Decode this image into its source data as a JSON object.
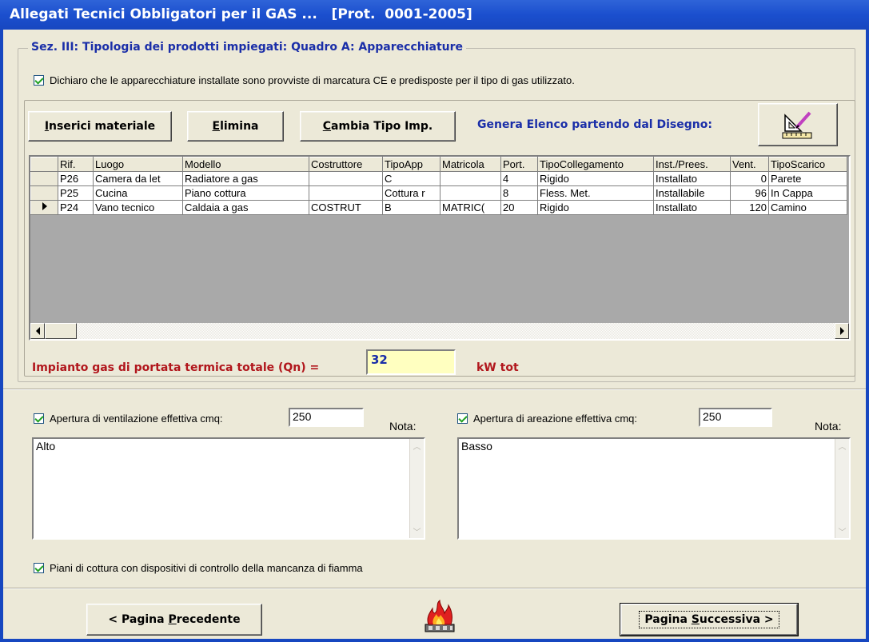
{
  "window": {
    "title": "Allegati Tecnici Obbligatori per il GAS ...   [Prot.  0001-2005]"
  },
  "section": {
    "title": "Sez. III: Tipologia dei prodotti impiegati:  Quadro A:  Apparecchiature",
    "ce_declaration": {
      "checked": true,
      "label": "Dichiaro che le apparecchiature installate sono provviste di marcatura CE e predisposte per il tipo di gas utilizzato."
    }
  },
  "toolbar": {
    "insert_label": "Inserici materiale",
    "delete_label": "Elimina",
    "change_type_label": "Cambia Tipo Imp.",
    "generate_label": "Genera Elenco partendo dal Disegno:",
    "drawing_icon": "drawing-tool-icon"
  },
  "grid": {
    "columns": [
      "Rif.",
      "Luogo",
      "Modello",
      "Costruttore",
      "TipoApp",
      "Matricola",
      "Port.",
      "TipoCollegamento",
      "Inst./Prees.",
      "Vent.",
      "TipoScarico"
    ],
    "rows": [
      {
        "current": false,
        "cells": [
          "P26",
          "Camera da let",
          "Radiatore a gas",
          "",
          "C",
          "",
          "4",
          "Rigido",
          "Installato",
          "0",
          "Parete"
        ]
      },
      {
        "current": false,
        "cells": [
          "P25",
          "Cucina",
          "Piano cottura",
          "",
          "Cottura r",
          "",
          "8",
          "Fless. Met.",
          "Installabile",
          "96",
          "In Cappa"
        ]
      },
      {
        "current": true,
        "cells": [
          "P24",
          "Vano tecnico",
          "Caldaia a gas",
          "COSTRUT",
          "B",
          "MATRIC(",
          "20",
          "Rigido",
          "Installato",
          "120",
          "Camino"
        ]
      }
    ]
  },
  "total": {
    "label": "Impianto gas di portata termica totale (Qn) =",
    "value": "32",
    "unit": "kW tot"
  },
  "ventilation": {
    "checked": true,
    "label": "Apertura di ventilazione effettiva cmq:",
    "value": "250",
    "nota_label": "Nota:",
    "nota_text": "Alto"
  },
  "aeration": {
    "checked": true,
    "label": "Apertura di areazione effettiva cmq:",
    "value": "250",
    "nota_label": "Nota:",
    "nota_text": "Basso"
  },
  "flame_control": {
    "checked": true,
    "label": "Piani di cottura con dispositivi di controllo della mancanza di fiamma"
  },
  "nav": {
    "prev_label": "< Pagina Precedente",
    "next_label": "Pagina Successiva >",
    "logo_icon": "gas-flame-icon"
  }
}
